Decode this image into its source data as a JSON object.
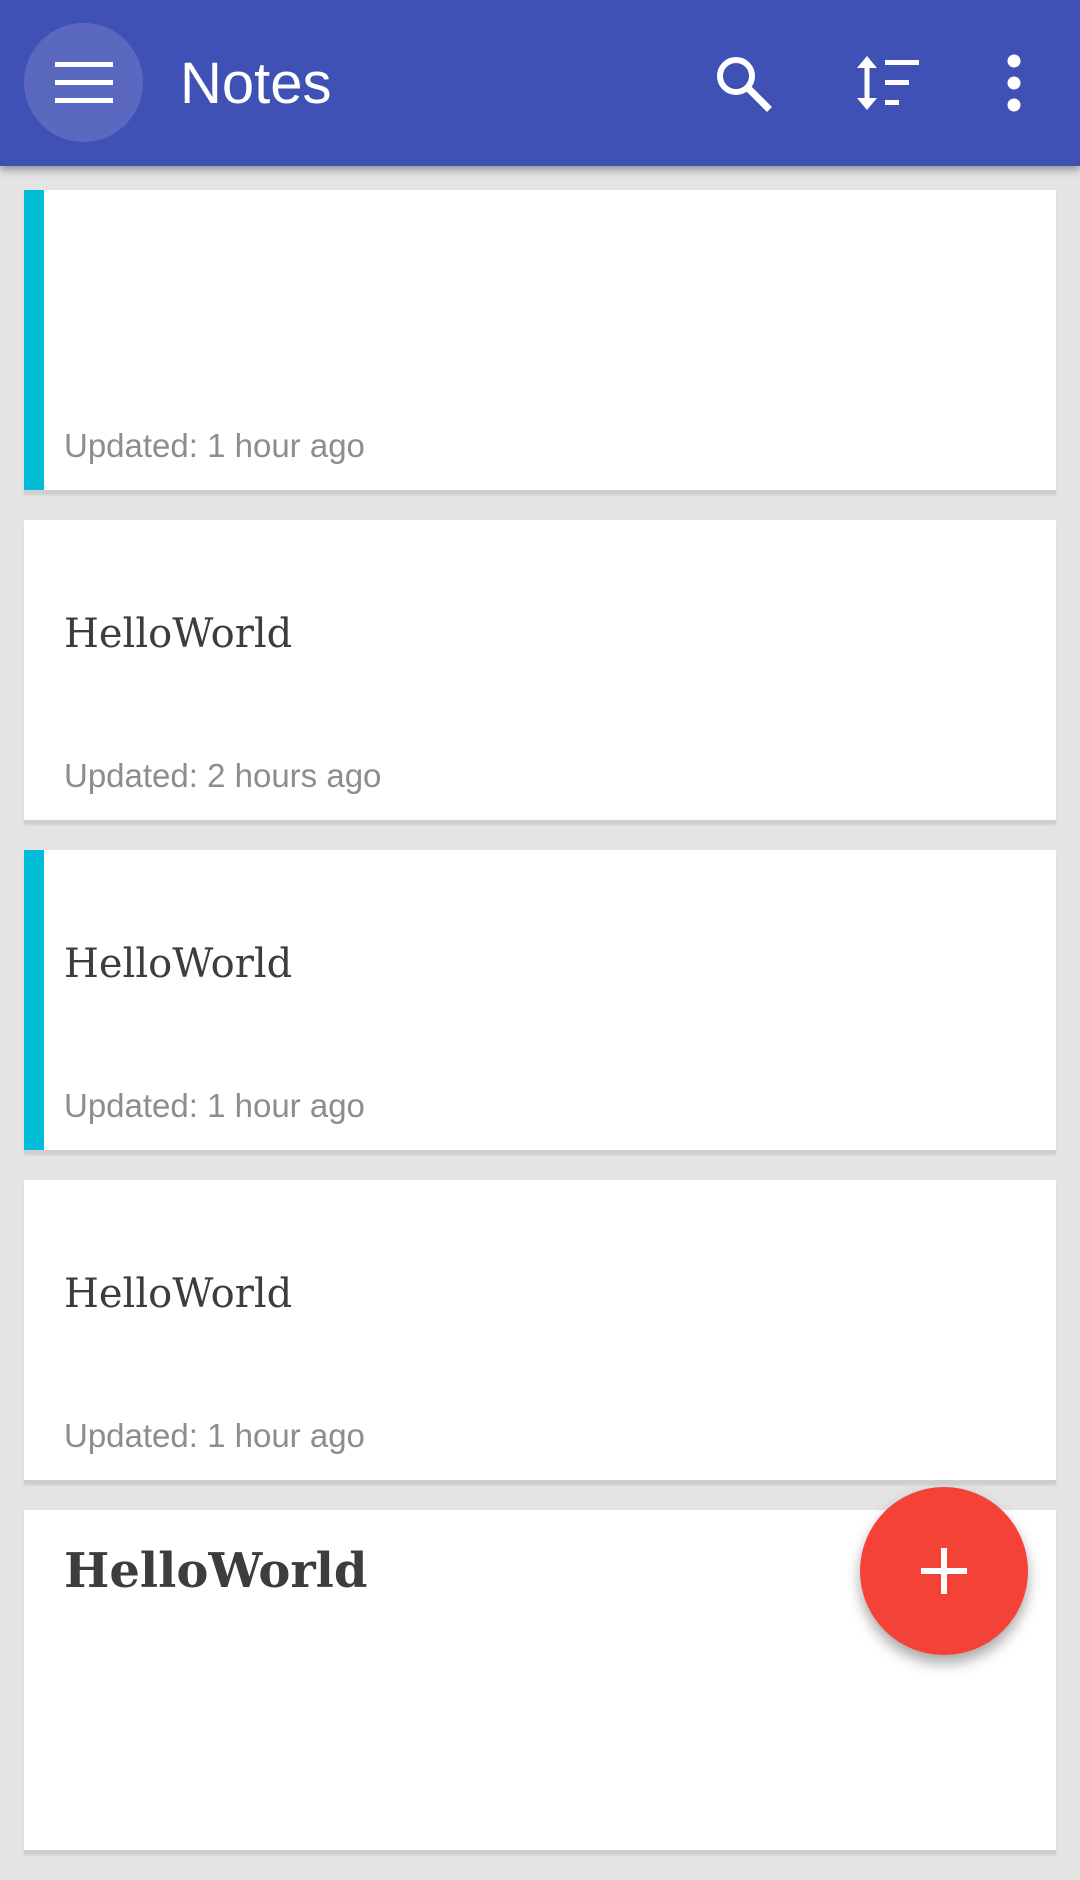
{
  "app": {
    "title": "Notes",
    "primary_color": "#3f51b5",
    "accent_color": "#00bcd4",
    "fab_color": "#f44336"
  },
  "toolbar": {
    "menu_icon": "hamburger-menu-icon",
    "search_icon": "search-icon",
    "sort_icon": "sort-icon",
    "overflow_icon": "more-vertical-icon"
  },
  "notes": [
    {
      "title": "",
      "updated": "Updated: 1 hour ago",
      "color_tag": true
    },
    {
      "title": "HelloWorld",
      "updated": "Updated: 2 hours ago",
      "color_tag": false
    },
    {
      "title": "HelloWorld",
      "updated": "Updated: 1 hour ago",
      "color_tag": true
    },
    {
      "title": "HelloWorld",
      "updated": "Updated: 1 hour ago",
      "color_tag": false
    },
    {
      "title": "HelloWorld",
      "updated": "",
      "color_tag": false
    }
  ],
  "fab": {
    "icon": "plus-icon"
  }
}
